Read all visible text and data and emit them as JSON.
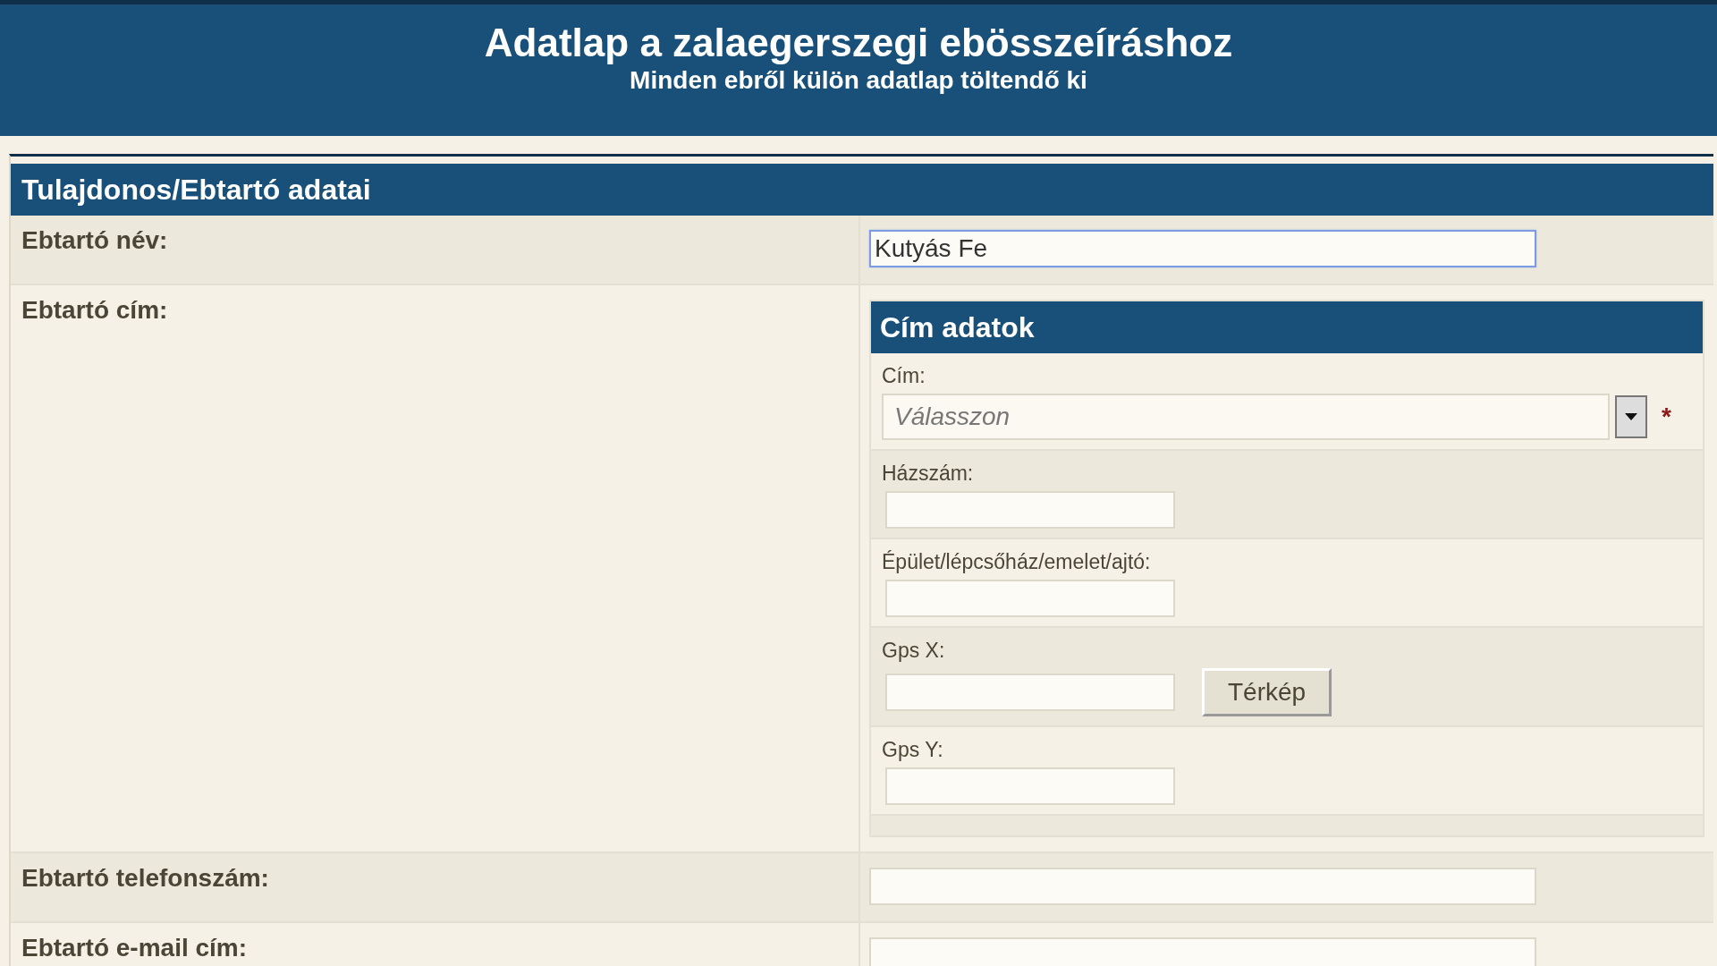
{
  "header": {
    "title": "Adatlap a zalaegerszegi ebösszeíráshoz",
    "subtitle": "Minden ebről külön adatlap töltendő ki"
  },
  "section": {
    "title": "Tulajdonos/Ebtartó adatai",
    "rows": [
      {
        "label": "Ebtartó név:",
        "kind": "text",
        "value": "Kutyás Fe",
        "focused": true
      },
      {
        "label": "Ebtartó cím:",
        "kind": "address",
        "address": {
          "title": "Cím adatok",
          "fields": [
            {
              "label": "Cím:",
              "kind": "select",
              "placeholder": "Válasszon",
              "required_mark": "*"
            },
            {
              "label": "Házszám:",
              "kind": "text"
            },
            {
              "label": "Épület/lépcsőház/emelet/ajtó:",
              "kind": "text"
            },
            {
              "label": "Gps X:",
              "kind": "text",
              "button": "Térkép"
            },
            {
              "label": "Gps Y:",
              "kind": "text"
            }
          ]
        }
      },
      {
        "label": "Ebtartó telefonszám:",
        "kind": "text",
        "value": "",
        "focused": false
      },
      {
        "label": "Ebtartó e-mail cím:",
        "kind": "text",
        "value": "",
        "focused": false
      }
    ]
  }
}
